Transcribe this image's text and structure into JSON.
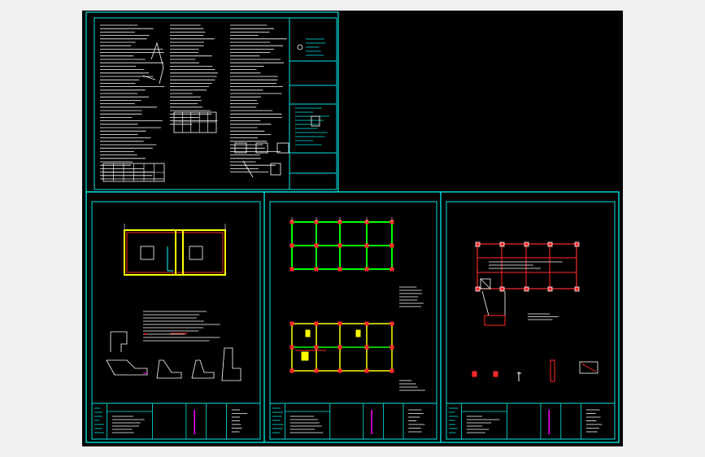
{
  "viewer": {
    "background": "#f0f0f0",
    "canvas_background": "#000000",
    "drawing_label": ""
  },
  "colors": {
    "frame": "#00e5e5",
    "text": "#ffffff",
    "wall": "#ffff00",
    "beam": "#00ff00",
    "column": "#ff2a2a",
    "accent": "#ff00ff",
    "dim": "#00ffff"
  },
  "sheets": [
    {
      "id": "general-notes",
      "kind": "notes"
    },
    {
      "id": "foundation-plan",
      "kind": "plan"
    },
    {
      "id": "beam-plan",
      "kind": "plan"
    },
    {
      "id": "column-plan",
      "kind": "plan"
    }
  ]
}
